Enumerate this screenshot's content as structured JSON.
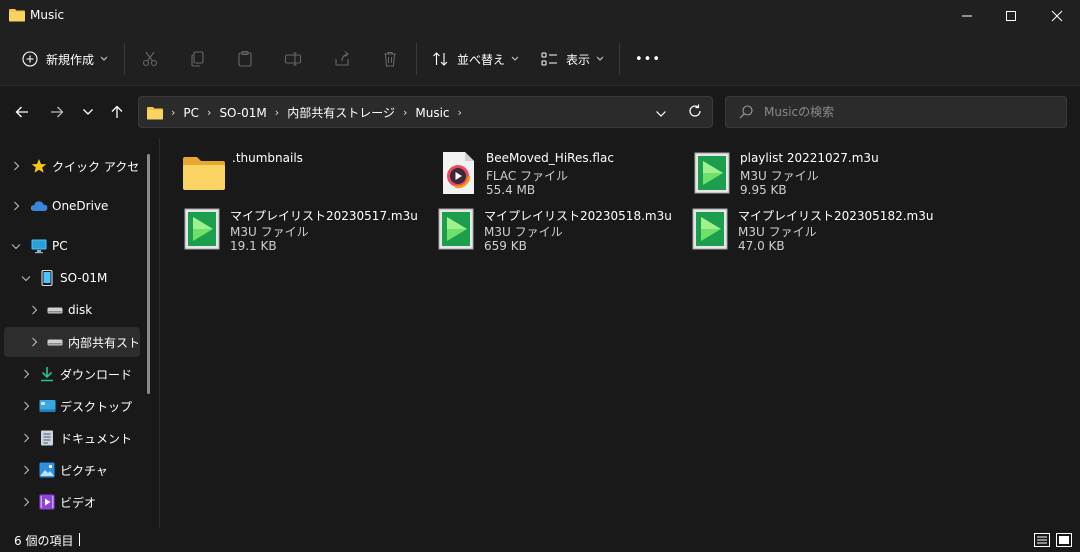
{
  "window": {
    "title": "Music",
    "minimize_symbol": "─",
    "maximize_symbol": "☐",
    "close_symbol": "✕"
  },
  "commandbar": {
    "new_label": "新規作成",
    "sort_label": "並べ替え",
    "view_label": "表示",
    "more_label": "•••"
  },
  "address": {
    "crumbs": [
      "PC",
      "SO-01M",
      "内部共有ストレージ",
      "Music"
    ],
    "search_placeholder": "Musicの検索"
  },
  "sidebar": {
    "items": [
      {
        "label": "クイック アクセス",
        "icon": "star-icon"
      },
      {
        "label": "OneDrive",
        "icon": "cloud-icon"
      },
      {
        "label": "PC",
        "icon": "monitor-icon"
      },
      {
        "label": "SO-01M",
        "icon": "phone-icon"
      },
      {
        "label": "disk",
        "icon": "drive-icon"
      },
      {
        "label": "内部共有ストレージ",
        "icon": "drive-icon"
      },
      {
        "label": "ダウンロード",
        "icon": "download-icon"
      },
      {
        "label": "デスクトップ",
        "icon": "desktop-icon"
      },
      {
        "label": "ドキュメント",
        "icon": "document-icon"
      },
      {
        "label": "ピクチャ",
        "icon": "pictures-icon"
      },
      {
        "label": "ビデオ",
        "icon": "video-icon"
      }
    ]
  },
  "files": [
    {
      "name": ".thumbnails",
      "type": "",
      "size": "",
      "icon": "folder-icon"
    },
    {
      "name": "BeeMoved_HiRes.flac",
      "type": "FLAC ファイル",
      "size": "55.4 MB",
      "icon": "audio-file-icon"
    },
    {
      "name": "playlist 20221027.m3u",
      "type": "M3U ファイル",
      "size": "9.95 KB",
      "icon": "playlist-file-icon"
    },
    {
      "name": "マイプレイリスト20230517.m3u",
      "type": "M3U ファイル",
      "size": "19.1 KB",
      "icon": "playlist-file-icon"
    },
    {
      "name": "マイプレイリスト20230518.m3u",
      "type": "M3U ファイル",
      "size": "659 KB",
      "icon": "playlist-file-icon"
    },
    {
      "name": "マイプレイリスト202305182.m3u",
      "type": "M3U ファイル",
      "size": "47.0 KB",
      "icon": "playlist-file-icon"
    }
  ],
  "status": {
    "item_count": "6 個の項目"
  },
  "colors": {
    "background": "#191919",
    "chrome": "#202020",
    "folder": "#f8c542",
    "accent": "#4cc2ff"
  }
}
